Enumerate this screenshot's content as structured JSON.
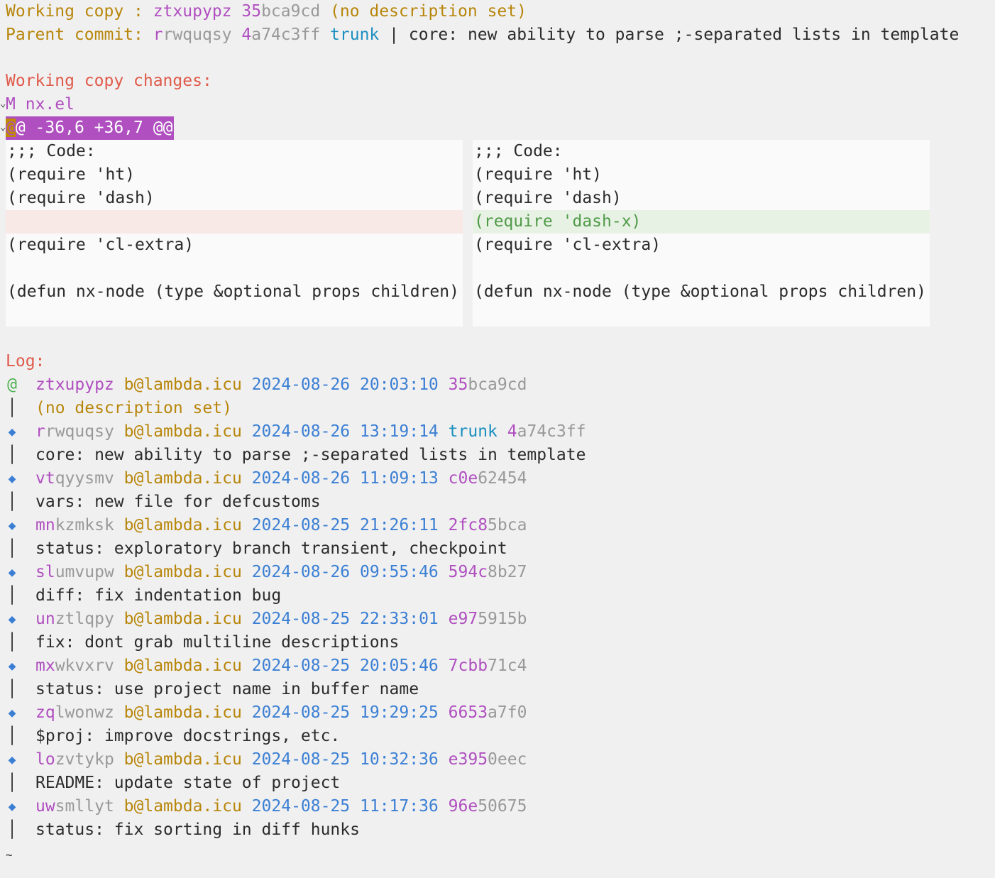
{
  "header": {
    "working_copy_label": "Working copy :",
    "wc_change_prefix": "ztxupypz",
    "wc_change_rest": "",
    "wc_commit_prefix": "35",
    "wc_commit_rest": "bca9cd",
    "wc_description": "(no description set)",
    "parent_label": "Parent commit:",
    "parent_change_prefix": "r",
    "parent_change_rest": "rwquqsy",
    "parent_commit_prefix": "4",
    "parent_commit_rest": "a74c3ff",
    "parent_bookmark": "trunk",
    "parent_separator": "|",
    "parent_description": "core: new ability to parse ;-separated lists in template"
  },
  "changes": {
    "title": "Working copy changes:",
    "file_status": "M",
    "file_name": "nx.el",
    "hunk_cursor": "@",
    "hunk_header": "@ -36,6 +36,7 @@",
    "left_lines": [
      ";;; Code:",
      "(require 'ht)",
      "(require 'dash)",
      "",
      "(require 'cl-extra)",
      "",
      "(defun nx-node (type &optional props children)",
      ""
    ],
    "right_lines": [
      ";;; Code:",
      "(require 'ht)",
      "(require 'dash)",
      "(require 'dash-x)",
      "(require 'cl-extra)",
      "",
      "(defun nx-node (type &optional props children)",
      ""
    ]
  },
  "log": {
    "title": "Log:",
    "end_marker": "~",
    "entries": [
      {
        "graph": "@",
        "cp": "ztxupypz",
        "cr": "",
        "email": "b@lambda.icu",
        "date": "2024-08-26 20:03:10",
        "bookmark": "",
        "hp": "35",
        "hr": "bca9cd",
        "desc": "(no description set)",
        "desc_style": "orange"
      },
      {
        "graph": "◆",
        "cp": "r",
        "cr": "rwquqsy",
        "email": "b@lambda.icu",
        "date": "2024-08-26 13:19:14",
        "bookmark": "trunk",
        "hp": "4",
        "hr": "a74c3ff",
        "desc": "core: new ability to parse ;-separated lists in template",
        "desc_style": "plain"
      },
      {
        "graph": "◆",
        "cp": "vt",
        "cr": "qyysmv",
        "email": "b@lambda.icu",
        "date": "2024-08-26 11:09:13",
        "bookmark": "",
        "hp": "c0e",
        "hr": "62454",
        "desc": "vars: new file for defcustoms",
        "desc_style": "plain"
      },
      {
        "graph": "◆",
        "cp": "mn",
        "cr": "kzmksk",
        "email": "b@lambda.icu",
        "date": "2024-08-25 21:26:11",
        "bookmark": "",
        "hp": "2fc8",
        "hr": "5bca",
        "desc": "status: exploratory branch transient, checkpoint",
        "desc_style": "plain"
      },
      {
        "graph": "◆",
        "cp": "sl",
        "cr": "umvupw",
        "email": "b@lambda.icu",
        "date": "2024-08-26 09:55:46",
        "bookmark": "",
        "hp": "594c",
        "hr": "8b27",
        "desc": "diff: fix indentation bug",
        "desc_style": "plain"
      },
      {
        "graph": "◆",
        "cp": "un",
        "cr": "ztlqpy",
        "email": "b@lambda.icu",
        "date": "2024-08-25 22:33:01",
        "bookmark": "",
        "hp": "e97",
        "hr": "5915b",
        "desc": "fix: dont grab multiline descriptions",
        "desc_style": "plain"
      },
      {
        "graph": "◆",
        "cp": "mx",
        "cr": "wkvxrv",
        "email": "b@lambda.icu",
        "date": "2024-08-25 20:05:46",
        "bookmark": "",
        "hp": "7cbb",
        "hr": "71c4",
        "desc": "status: use project name in buffer name",
        "desc_style": "plain"
      },
      {
        "graph": "◆",
        "cp": "zq",
        "cr": "lwonwz",
        "email": "b@lambda.icu",
        "date": "2024-08-25 19:29:25",
        "bookmark": "",
        "hp": "6653",
        "hr": "a7f0",
        "desc": "$proj: improve docstrings, etc.",
        "desc_style": "plain"
      },
      {
        "graph": "◆",
        "cp": "lo",
        "cr": "zvtykp",
        "email": "b@lambda.icu",
        "date": "2024-08-25 10:32:36",
        "bookmark": "",
        "hp": "e395",
        "hr": "0eec",
        "desc": "README: update state of project",
        "desc_style": "plain"
      },
      {
        "graph": "◆",
        "cp": "uw",
        "cr": "smllyt",
        "email": "b@lambda.icu",
        "date": "2024-08-25 11:17:36",
        "bookmark": "",
        "hp": "96e",
        "hr": "50675",
        "desc": "status: fix sorting in diff hunks",
        "desc_style": "plain"
      }
    ]
  },
  "colors": {
    "change_id_prefix": "#b04fc0",
    "id_rest": "#999999",
    "email": "#b8860b",
    "date": "#3b7fd4",
    "bookmark": "#1a8fbf",
    "section_title": "#e05a4a",
    "added": "#4f9a48",
    "hunk_bg": "#b04fc0"
  }
}
